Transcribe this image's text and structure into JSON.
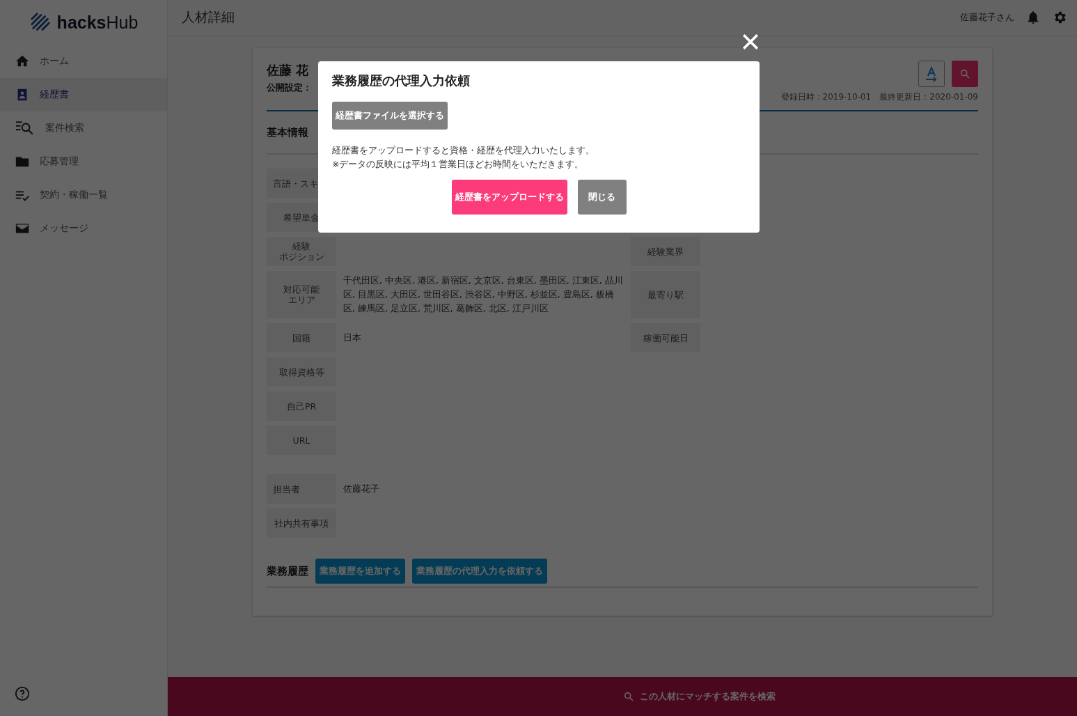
{
  "sidebar": {
    "logo": "**hacks**Hub",
    "items": [
      {
        "label": "ホーム",
        "selected": false
      },
      {
        "label": "経歴書",
        "selected": true
      },
      {
        "label": "案件検索",
        "selected": false
      },
      {
        "label": "応募管理",
        "selected": false
      },
      {
        "label": "契約・稼働一覧",
        "selected": false
      },
      {
        "label": "メッセージ",
        "selected": false
      }
    ]
  },
  "header": {
    "title": "人材詳細",
    "user": "佐藤花子さん"
  },
  "profile": {
    "name": "佐藤 花",
    "visibility_label": "公開設定：",
    "registered": "登録日時：2019-10-01",
    "updated": "最終更新日：2020-01-09"
  },
  "basic_info": {
    "heading": "基本情報",
    "rows": [
      {
        "label": "言語・スキ"
      },
      {
        "label": "希望単金"
      },
      {
        "label_lines": [
          "経験",
          "ポジション"
        ],
        "side_label": "経験業界"
      },
      {
        "label_lines": [
          "対応可能",
          "エリア"
        ],
        "value": "千代田区, 中央区, 港区, 新宿区, 文京区, 台東区, 墨田区, 江東区, 品川区, 目黒区, 大田区, 世田谷区, 渋谷区, 中野区, 杉並区, 豊島区, 板橋区, 練馬区, 足立区, 荒川区, 葛飾区, 北区, 江戸川区",
        "side_label": "最寄り駅"
      },
      {
        "label": "国籍",
        "value": "日本",
        "side_label": "稼働可能日"
      },
      {
        "label": "取得資格等"
      },
      {
        "label": "自己PR"
      },
      {
        "label": "URL"
      }
    ],
    "staff_rows": [
      {
        "label": "担当者",
        "value": "佐藤花子"
      },
      {
        "label": "社内共有事項"
      }
    ]
  },
  "work_history": {
    "heading": "業務履歴",
    "buttons": [
      "業務履歴を追加する",
      "業務履歴の代理入力を依頼する"
    ]
  },
  "bottom_bar": {
    "label": "この人材にマッチする案件を検索"
  },
  "modal": {
    "title": "業務履歴の代理入力依頼",
    "file_button": "経歴書ファイルを選択する",
    "notes": [
      "経歴書をアップロードすると資格・経歴を代理入力いたします。",
      "※データの反映には平均１営業日ほどお時間をいただきます。"
    ],
    "upload_button": "経歴書をアップロードする",
    "close_button": "閉じる"
  }
}
